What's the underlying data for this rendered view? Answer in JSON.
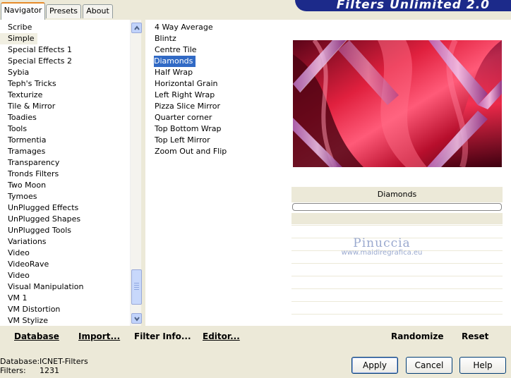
{
  "tabs": [
    "Navigator",
    "Presets",
    "About"
  ],
  "banner_title": "Filters Unlimited 2.0",
  "categories": [
    "Scribe",
    "Simple",
    "Special Effects 1",
    "Special Effects 2",
    "Sybia",
    "Teph's Tricks",
    "Texturize",
    "Tile & Mirror",
    "Toadies",
    "Tools",
    "Tormentia",
    "Tramages",
    "Transparency",
    "Tronds Filters",
    "Two Moon",
    "Tymoes",
    "UnPlugged Effects",
    "UnPlugged Shapes",
    "UnPlugged Tools",
    "Variations",
    "Video",
    "VideoRave",
    "Video",
    "Visual Manipulation",
    "VM 1",
    "VM Distortion",
    "VM Stylize"
  ],
  "selected_category": "Simple",
  "filters": [
    "4 Way Average",
    "Blintz",
    "Centre Tile",
    "Diamonds",
    "Half Wrap",
    "Horizontal Grain",
    "Left Right Wrap",
    "Pizza Slice Mirror",
    "Quarter corner",
    "Top Bottom Wrap",
    "Top Left Mirror",
    "Zoom Out and Flip"
  ],
  "selected_filter": "Diamonds",
  "preview": {
    "filter_name": "Diamonds"
  },
  "watermark": {
    "name": "Pinuccia",
    "url": "www.maidiregrafica.eu"
  },
  "toolbar": {
    "database": "Database",
    "import": "Import...",
    "filter_info": "Filter Info...",
    "editor": "Editor...",
    "randomize": "Randomize",
    "reset": "Reset"
  },
  "status": {
    "database_label": "Database:",
    "database_value": "ICNET-Filters",
    "filters_label": "Filters:",
    "filters_value": "1231"
  },
  "buttons": {
    "apply": "Apply",
    "cancel": "Cancel",
    "help": "Help"
  }
}
